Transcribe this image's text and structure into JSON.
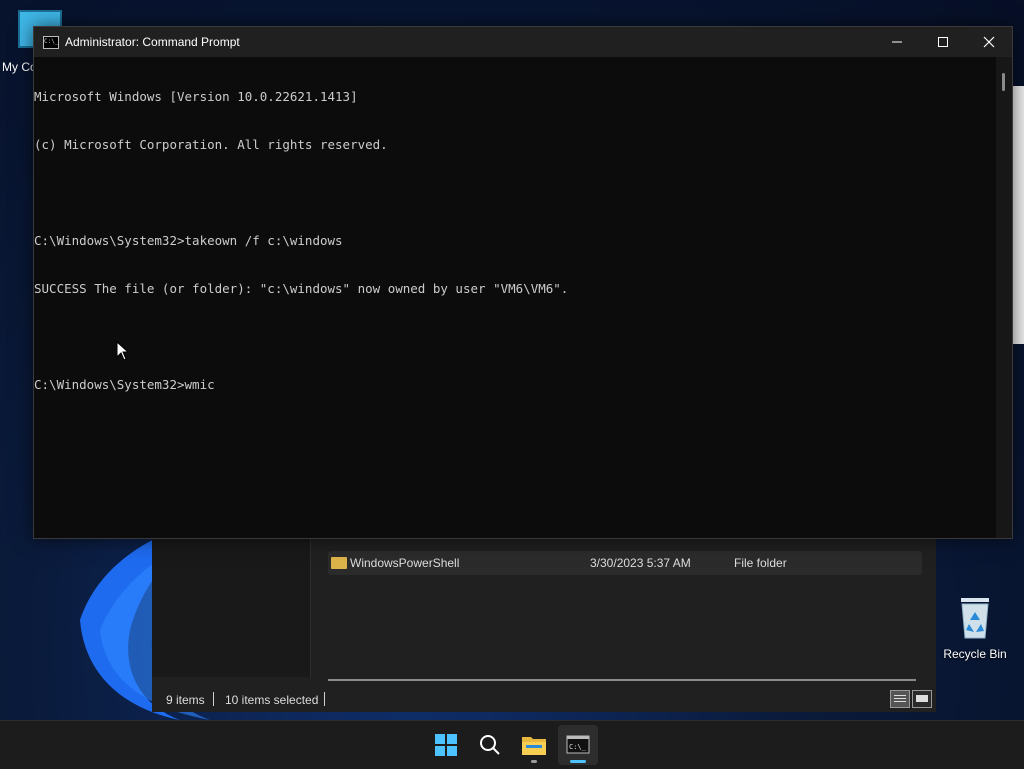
{
  "desktop": {
    "icons": {
      "my_computer": {
        "label": "My Co"
      },
      "recycle_bin": {
        "label": "Recycle Bin"
      }
    }
  },
  "cmd": {
    "title": "Administrator: Command Prompt",
    "lines": [
      "Microsoft Windows [Version 10.0.22621.1413]",
      "(c) Microsoft Corporation. All rights reserved.",
      "",
      "C:\\Windows\\System32>takeown /f c:\\windows",
      "SUCCESS The file (or folder): \"c:\\windows\" now owned by user \"VM6\\VM6\".",
      "",
      "C:\\Windows\\System32>wmic"
    ],
    "controls": {
      "minimize": "minimize-icon",
      "maximize": "maximize-icon",
      "close": "close-icon"
    }
  },
  "explorer": {
    "row": {
      "name": "WindowsPowerShell",
      "date": "3/30/2023 5:37 AM",
      "type": "File folder"
    },
    "status": {
      "items": "9 items",
      "selected": "10 items selected"
    }
  },
  "taskbar": {
    "items": [
      "windows-start-icon",
      "search-icon",
      "file-explorer-icon",
      "command-prompt-icon"
    ]
  },
  "colors": {
    "console_bg": "#0c0c0c",
    "console_text": "#cccccc",
    "taskbar_bg": "#1c1c1c",
    "accent": "#4cc2ff"
  }
}
